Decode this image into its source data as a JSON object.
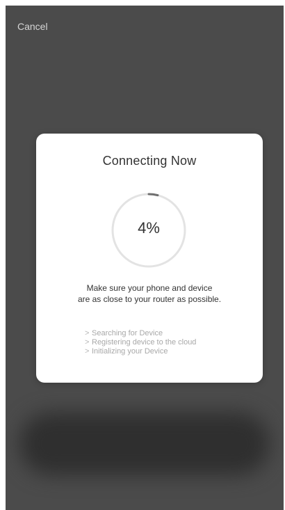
{
  "header": {
    "cancel_label": "Cancel"
  },
  "dialog": {
    "title": "Connecting Now",
    "progress": {
      "value_percent": 4,
      "label": "4%",
      "track_color": "#e3e3e3",
      "fill_color": "#6f6f6f"
    },
    "tip_lines": [
      "Make sure your phone and device",
      "are as close to your router as possible."
    ],
    "steps": [
      {
        "icon": "chevron-right-icon",
        "label": "Searching for Device"
      },
      {
        "icon": "chevron-right-icon",
        "label": "Registering device to the cloud"
      },
      {
        "icon": "chevron-right-icon",
        "label": "Initializing your Device"
      }
    ]
  },
  "colors": {
    "overlay": "#4b4b4b",
    "card": "#ffffff",
    "text_primary": "#333333",
    "text_muted": "#a8a8a8"
  }
}
